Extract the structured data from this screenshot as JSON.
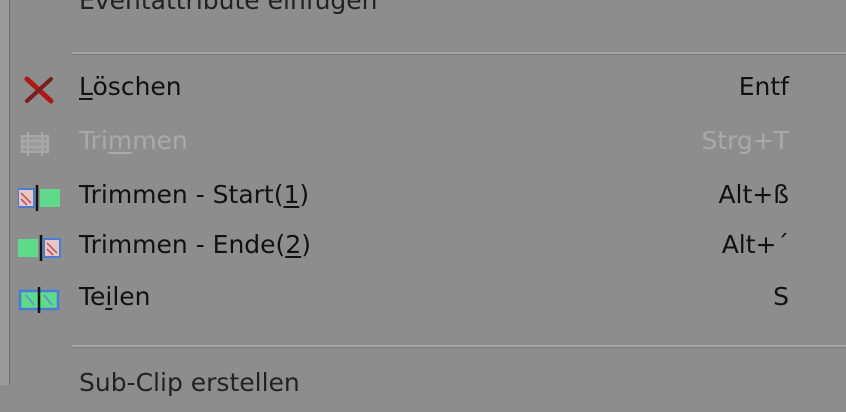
{
  "menu": {
    "items": [
      {
        "label": "Eventattribute einfügen",
        "shortcut": "",
        "state": "disabled",
        "icon": "none"
      },
      {
        "label_pre": "",
        "label_ul": "L",
        "label_post": "öschen",
        "shortcut": "Entf",
        "state": "enabled",
        "icon": "delete-x-icon"
      },
      {
        "label_pre": "Tri",
        "label_ul": "m",
        "label_post": "men",
        "shortcut": "Strg+T",
        "state": "disabled",
        "icon": "trim-icon"
      },
      {
        "label_pre": "Trimmen - Start(",
        "label_ul": "1",
        "label_post": ")",
        "shortcut": "Alt+ß",
        "state": "enabled",
        "icon": "trim-start-icon"
      },
      {
        "label_pre": "Trimmen - Ende(",
        "label_ul": "2",
        "label_post": ")",
        "shortcut": "Alt+´",
        "state": "enabled",
        "icon": "trim-end-icon"
      },
      {
        "label_pre": "Te",
        "label_ul": "i",
        "label_post": "len",
        "shortcut": "S",
        "state": "enabled",
        "icon": "split-icon"
      },
      {
        "label": "Sub-Clip erstellen",
        "shortcut": "",
        "state": "enabled",
        "icon": "none"
      }
    ]
  },
  "colors": {
    "menu_bg": "#8d8d8d",
    "delete_red": "#b01818",
    "clip_green": "#5fd98a",
    "clip_blue": "#4a7bd6"
  }
}
